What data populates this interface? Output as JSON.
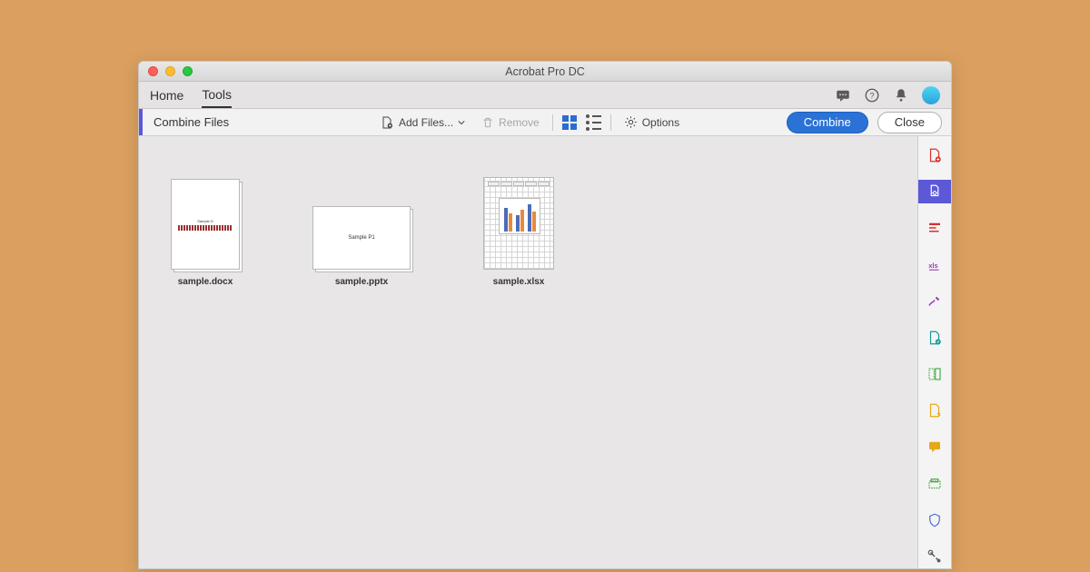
{
  "window": {
    "title": "Acrobat Pro DC"
  },
  "tabs": {
    "home": "Home",
    "tools": "Tools"
  },
  "toolbar": {
    "title": "Combine Files",
    "add_files": "Add Files...",
    "remove": "Remove",
    "options": "Options",
    "combine": "Combine",
    "close": "Close"
  },
  "files": [
    {
      "name": "sample.docx",
      "preview": "Sample D"
    },
    {
      "name": "sample.pptx",
      "preview": "Sample P1"
    },
    {
      "name": "sample.xlsx"
    }
  ],
  "rail_icons": [
    "create-pdf",
    "combine-files",
    "edit-pdf",
    "export-pdf",
    "sign",
    "fill-sign",
    "organize",
    "send-comments",
    "comment",
    "scan",
    "protect",
    "tools-more"
  ]
}
